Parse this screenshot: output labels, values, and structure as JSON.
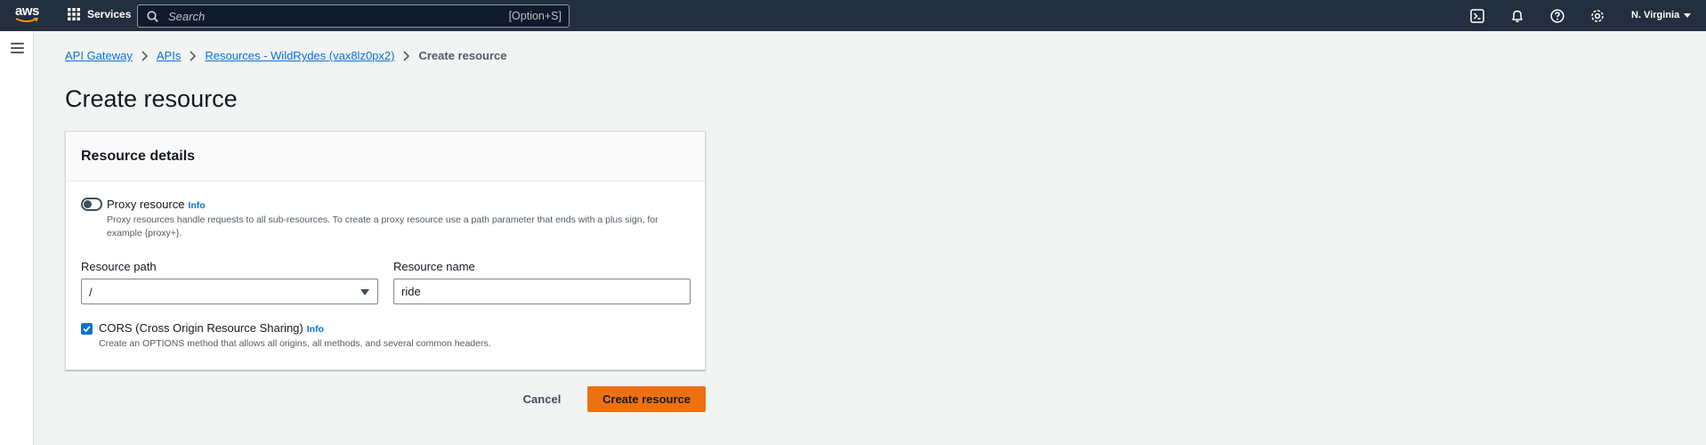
{
  "topnav": {
    "logo_text": "aws",
    "services_label": "Services",
    "search": {
      "placeholder": "Search",
      "shortcut": "[Option+S]"
    },
    "region": "N. Virginia",
    "icons": [
      "cloudshell-icon",
      "bell-icon",
      "help-icon",
      "settings-icon"
    ]
  },
  "breadcrumb": {
    "items": [
      "API Gateway",
      "APIs",
      "Resources - WildRydes (vax8lz0px2)"
    ],
    "current": "Create resource"
  },
  "page": {
    "title": "Create resource"
  },
  "panel": {
    "title": "Resource details",
    "proxy": {
      "label": "Proxy resource",
      "info": "Info",
      "enabled": false,
      "description": "Proxy resources handle requests to all sub-resources. To create a proxy resource use a path parameter that ends with a plus sign, for example {proxy+}."
    },
    "resource_path": {
      "label": "Resource path",
      "value": "/"
    },
    "resource_name": {
      "label": "Resource name",
      "value": "ride"
    },
    "cors": {
      "label": "CORS (Cross Origin Resource Sharing)",
      "info": "Info",
      "checked": true,
      "description": "Create an OPTIONS method that allows all origins, all methods, and several common headers."
    }
  },
  "actions": {
    "cancel": "Cancel",
    "submit": "Create resource"
  },
  "colors": {
    "nav_bg": "#232f3e",
    "primary": "#ec7211",
    "link": "#0972d3"
  }
}
